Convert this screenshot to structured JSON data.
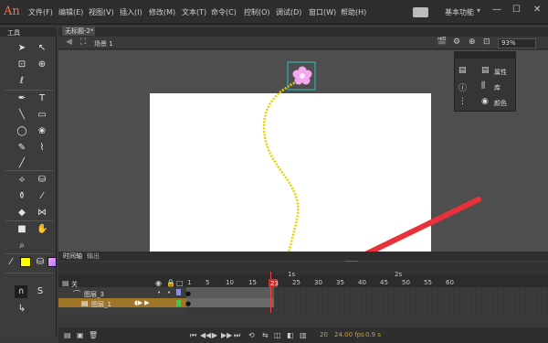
{
  "app": {
    "logo": "An"
  },
  "menu": [
    "文件(F)",
    "编辑(E)",
    "视图(V)",
    "插入(I)",
    "修改(M)",
    "文本(T)",
    "命令(C)",
    "控制(O)",
    "调试(D)",
    "窗口(W)",
    "帮助(H)"
  ],
  "workspace": {
    "label": "基本功能"
  },
  "tools": {
    "label": "工具"
  },
  "document": {
    "tab": "无标题-2*"
  },
  "scene": {
    "label": "场景 1",
    "zoom": "93%"
  },
  "panel": {
    "properties": "属性",
    "library": "库",
    "color": "颜色"
  },
  "timeline": {
    "tabs": [
      "时间轴",
      "输出"
    ],
    "header_label": "关",
    "ticks": [
      "1",
      "5",
      "10",
      "15",
      "20",
      "25",
      "30",
      "35",
      "40",
      "45",
      "50",
      "55",
      "60"
    ],
    "seconds": [
      "1s",
      "2s"
    ],
    "layers": [
      "图层_3",
      "图层_1"
    ],
    "current_frame": "23",
    "fps": "24.00 fps",
    "time": "0.9 s",
    "frame_count": "20"
  },
  "colors": {
    "stroke": "#ffff00",
    "accent": "#ff6a3d",
    "layer_highlight": "#a0752a",
    "playhead": "#ff3b3b"
  },
  "icons": {
    "tools": [
      "selection-icon",
      "subselection-icon",
      "free-transform-icon",
      "3d-rotation-icon",
      "lasso-icon",
      "pen-icon",
      "text-icon",
      "line-icon",
      "rectangle-icon",
      "oval-icon",
      "deco-icon",
      "pencil-icon",
      "brush-icon",
      "bone-icon",
      "paint-bucket-icon",
      "ink-bottle-icon",
      "eyedropper-icon",
      "eraser-icon",
      "camera-icon",
      "hand-icon",
      "zoom-icon"
    ]
  }
}
